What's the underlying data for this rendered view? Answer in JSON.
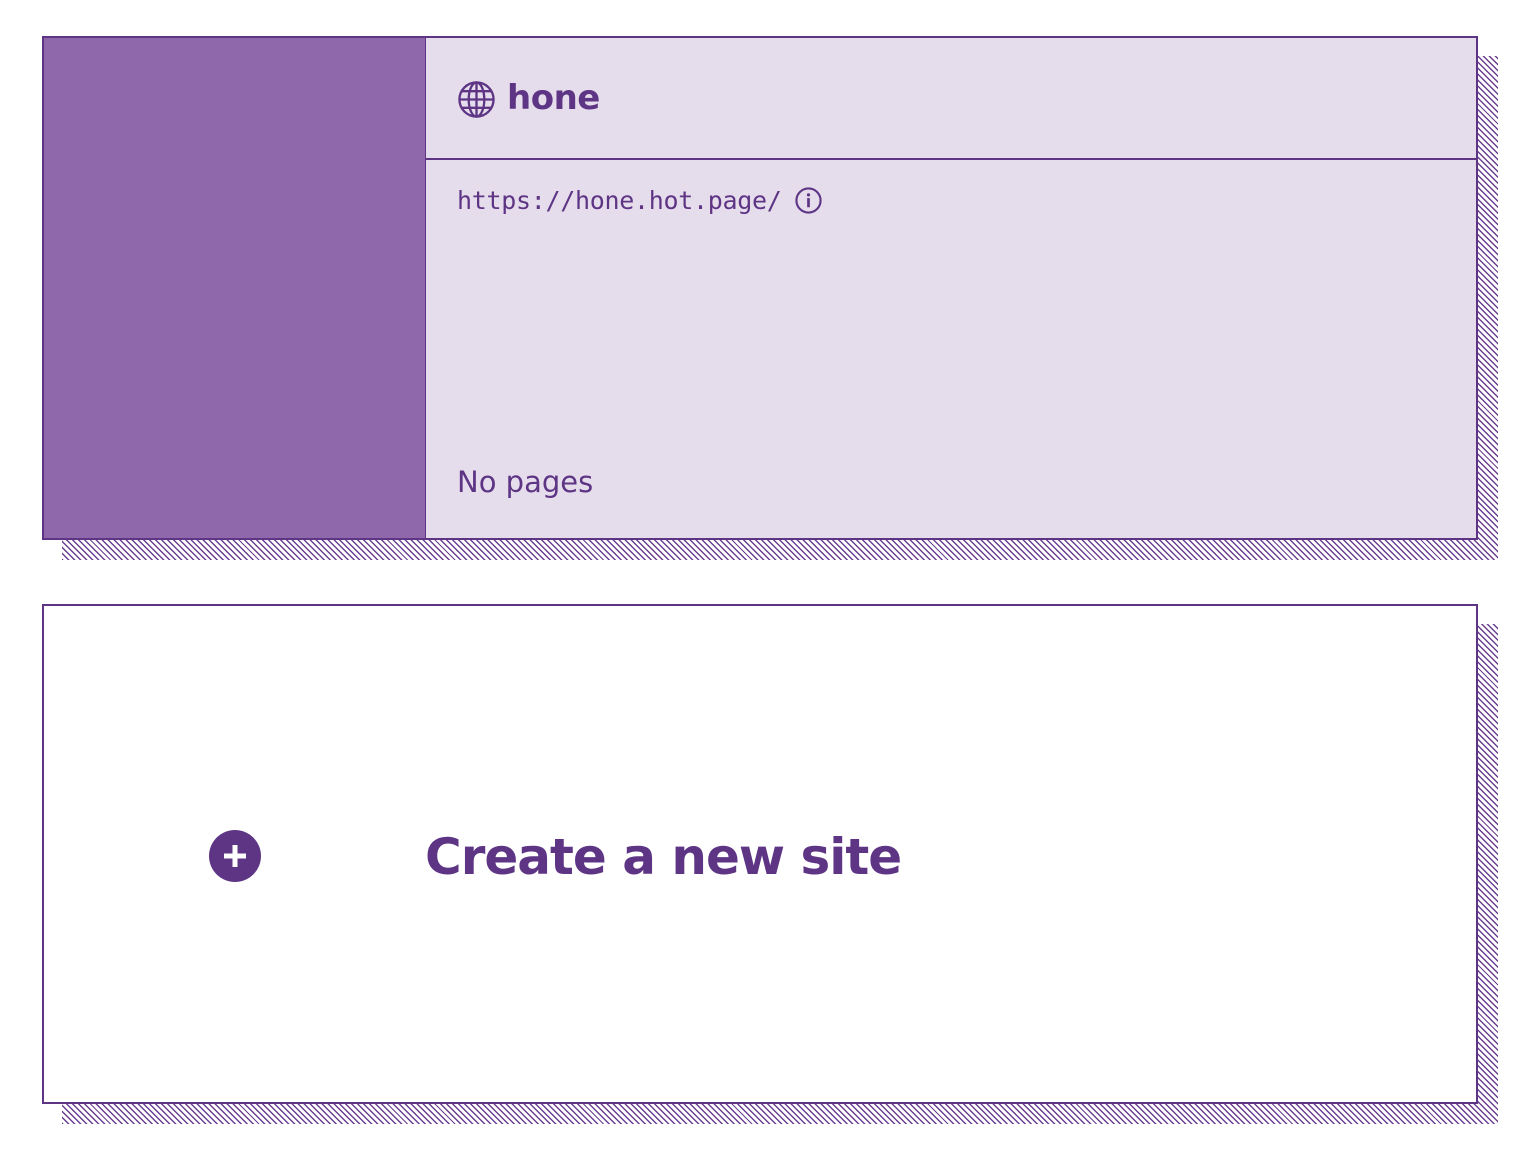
{
  "site": {
    "name": "hone",
    "url": "https://hone.hot.page/",
    "pages_status": "No pages",
    "globe_icon": "globe-icon",
    "info_icon": "info-icon"
  },
  "create": {
    "label": "Create a new site",
    "icon": "plus-circle-icon"
  },
  "colors": {
    "accent": "#5e3585",
    "thumbnail": "#8f68ab",
    "card_background": "#e6ddec",
    "page_background": "#ffffff"
  }
}
